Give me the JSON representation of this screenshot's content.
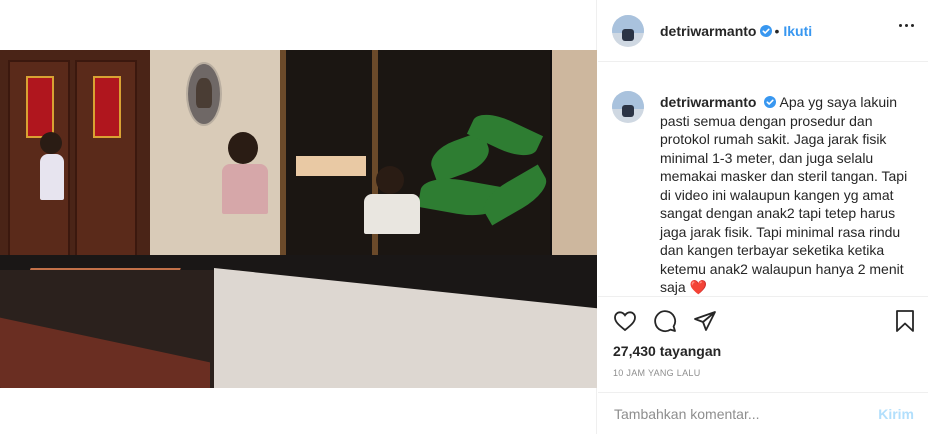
{
  "header": {
    "username": "detriwarmanto",
    "verified_icon": "verified-badge-icon",
    "separator": "•",
    "follow_label": "Ikuti",
    "more_icon": "more-options-icon"
  },
  "caption": {
    "username": "detriwarmanto",
    "text": "Apa yg saya lakuin pasti semua dengan prosedur dan protokol rumah sakit. Jaga jarak fisik minimal 1-3 meter, dan juga selalu memakai masker dan steril tangan. Tapi di video ini walaupun kangen yg amat sangat dengan anak2 tapi tetep harus jaga jarak fisik. Tapi minimal rasa rindu dan kangen terbayar seketika ketika ketemu anak2 walaupun hanya 2 menit saja",
    "emoji": "❤️"
  },
  "actions": {
    "like_icon": "heart-outline-icon",
    "comment_icon": "comment-icon",
    "share_icon": "paper-plane-icon",
    "save_icon": "bookmark-icon"
  },
  "views": "27,430 tayangan",
  "time_ago": "10 JAM YANG LALU",
  "comment": {
    "placeholder": "Tambahkan komentar...",
    "post_label": "Kirim"
  },
  "colors": {
    "accent": "#3897f0",
    "post_disabled": "#b2dffc",
    "heart": "#ed4956"
  }
}
